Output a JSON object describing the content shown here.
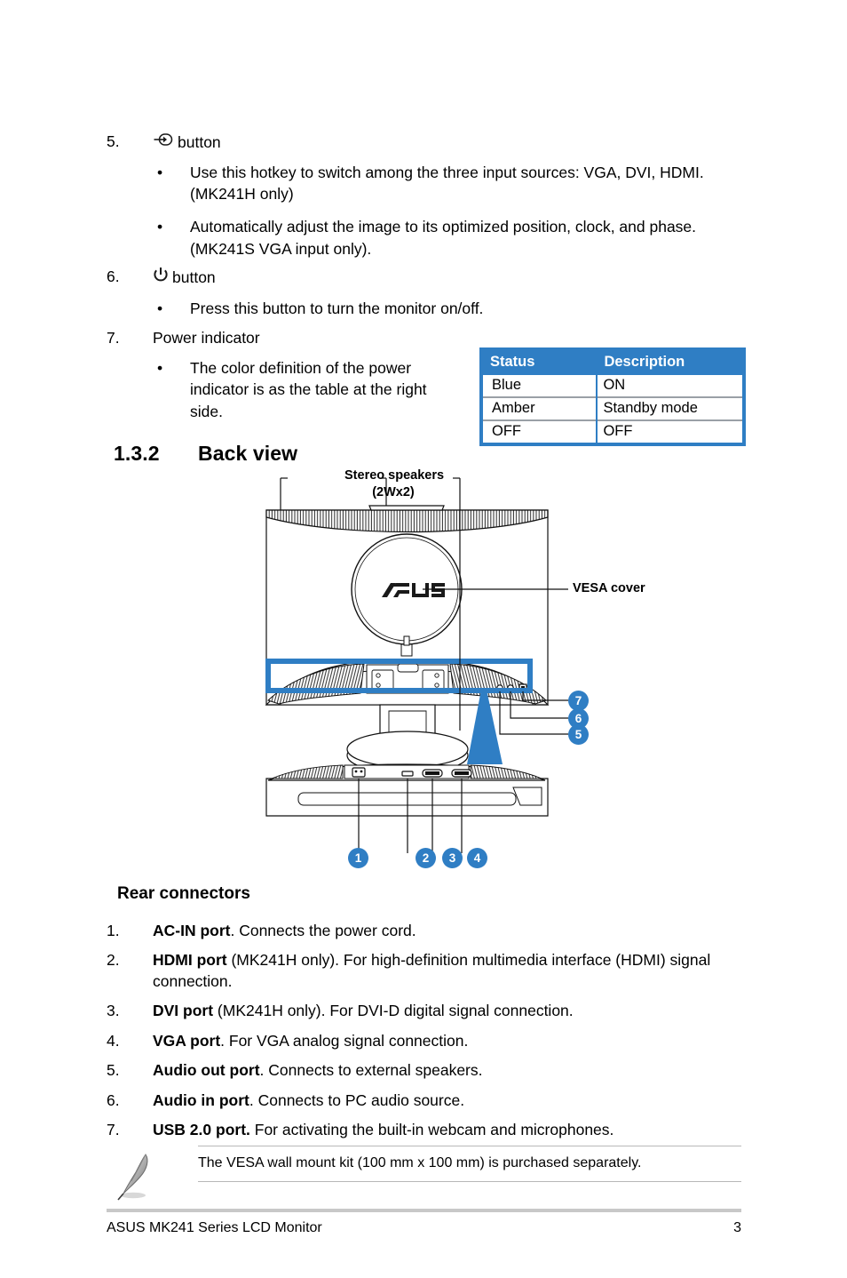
{
  "section_top": {
    "items": [
      {
        "num": "5.",
        "icon": "input-select-icon",
        "label": "button",
        "bullets": [
          "Use this hotkey to switch among the three input sources: VGA, DVI, HDMI. (MK241H only)",
          "Automatically adjust the image to its optimized position, clock, and phase. (MK241S VGA input only)."
        ]
      },
      {
        "num": "6.",
        "icon": "power-icon",
        "label": "button",
        "bullets": [
          "Press this button to turn the monitor on/off."
        ]
      },
      {
        "num": "7.",
        "icon": "",
        "label": "Power indicator",
        "bullets": [
          "The color definition of the power indicator is as the table at the right side."
        ]
      }
    ]
  },
  "status_table": {
    "headers": [
      "Status",
      "Description"
    ],
    "rows": [
      [
        "Blue",
        "ON"
      ],
      [
        "Amber",
        "Standby mode"
      ],
      [
        "OFF",
        "OFF"
      ]
    ],
    "accent_color": "#2f7ec4"
  },
  "heading": {
    "number": "1.3.2",
    "title": "Back view"
  },
  "figure": {
    "labels": {
      "speakers_line1": "Stereo speakers",
      "speakers_line2": "(2Wx2)",
      "vesa_cover": "VESA cover",
      "logo": "/SUS"
    },
    "callouts": [
      "1",
      "2",
      "3",
      "4",
      "5",
      "6",
      "7"
    ],
    "callout_color": "#2f7ec4"
  },
  "rear_connectors": {
    "title": "Rear connectors",
    "items": [
      {
        "num": "1.",
        "bold": "AC-IN port",
        "rest": ". Connects the power cord."
      },
      {
        "num": "2.",
        "bold": "HDMI port",
        "rest": " (MK241H only). For high-definition multimedia interface (HDMI) signal connection."
      },
      {
        "num": "3.",
        "bold": "DVI port",
        "rest": " (MK241H only). For DVI-D digital signal connection."
      },
      {
        "num": "4.",
        "bold": "VGA port",
        "rest": ". For VGA analog signal connection."
      },
      {
        "num": "5.",
        "bold": "Audio out port",
        "rest": ". Connects to external speakers."
      },
      {
        "num": "6.",
        "bold": "Audio in port",
        "rest": ". Connects to PC audio source."
      },
      {
        "num": "7.",
        "bold": "USB 2.0 port.",
        "rest": " For activating the built-in webcam and microphones."
      }
    ]
  },
  "note": {
    "icon": "note-pen-icon",
    "text": "The VESA wall mount kit (100 mm x 100 mm) is purchased separately."
  },
  "footer": {
    "left": "ASUS MK241 Series LCD Monitor",
    "page": "3"
  }
}
